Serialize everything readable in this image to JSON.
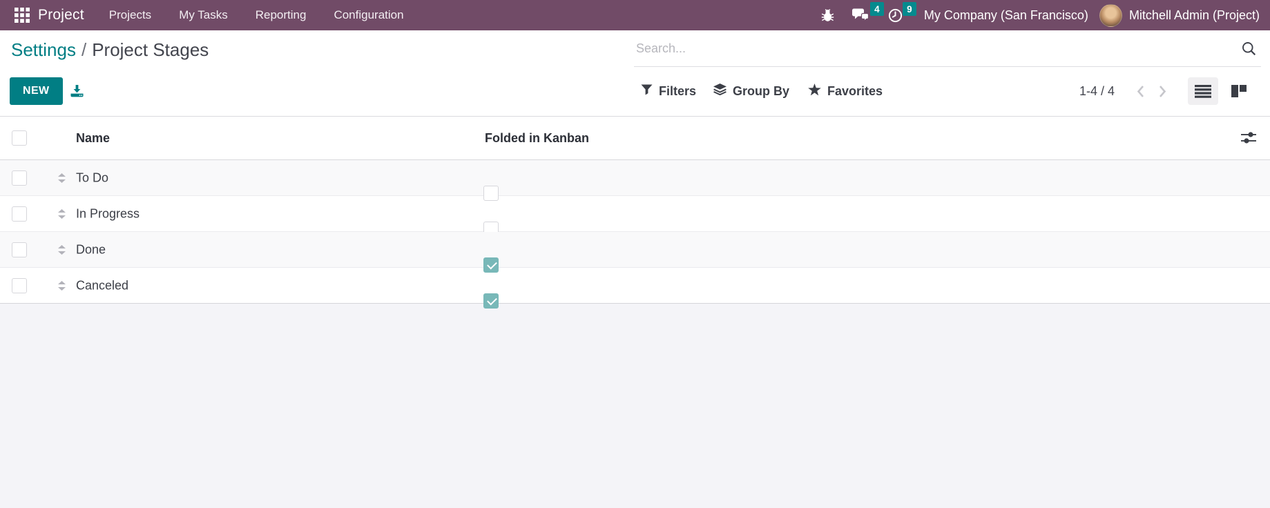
{
  "navbar": {
    "app_name": "Project",
    "menu_items": [
      "Projects",
      "My Tasks",
      "Reporting",
      "Configuration"
    ],
    "messages_badge": "4",
    "activities_badge": "9",
    "company": "My Company (San Francisco)",
    "user": "Mitchell Admin (Project)"
  },
  "breadcrumb": {
    "parent": "Settings",
    "separator": "/",
    "current": "Project Stages"
  },
  "search": {
    "placeholder": "Search..."
  },
  "actions": {
    "new_label": "NEW"
  },
  "search_panel": {
    "filters": "Filters",
    "group_by": "Group By",
    "favorites": "Favorites"
  },
  "pager": {
    "range": "1-4 / 4"
  },
  "table": {
    "headers": {
      "name": "Name",
      "folded": "Folded in Kanban"
    },
    "rows": [
      {
        "name": "To Do",
        "folded": false
      },
      {
        "name": "In Progress",
        "folded": false
      },
      {
        "name": "Done",
        "folded": true
      },
      {
        "name": "Canceled",
        "folded": true
      }
    ]
  },
  "colors": {
    "navbar_bg": "#714b67",
    "accent": "#017e84",
    "badge": "#058a8e",
    "checkbox_checked": "#78b8b8",
    "footer_bg": "#f4f4f8"
  }
}
